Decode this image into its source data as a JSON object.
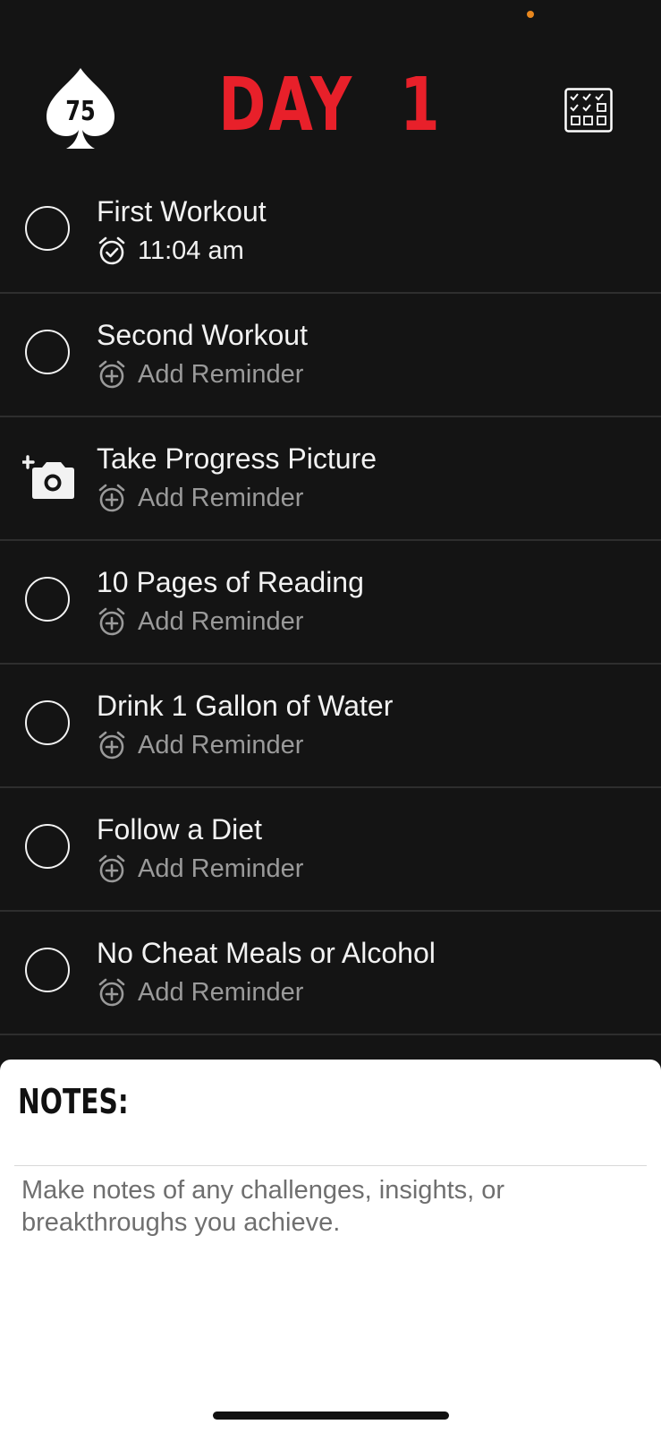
{
  "header": {
    "logo_text": "75",
    "day_title": "DAY  1",
    "calendar_icon": "calendar-checklist-icon"
  },
  "tasks": [
    {
      "title": "First Workout",
      "reminder": "11:04 am",
      "reminder_set": true,
      "control": "checkbox"
    },
    {
      "title": "Second Workout",
      "reminder": "Add Reminder",
      "reminder_set": false,
      "control": "checkbox"
    },
    {
      "title": "Take Progress Picture",
      "reminder": "Add Reminder",
      "reminder_set": false,
      "control": "add-photo"
    },
    {
      "title": "10 Pages of Reading",
      "reminder": "Add Reminder",
      "reminder_set": false,
      "control": "checkbox"
    },
    {
      "title": "Drink 1 Gallon of Water",
      "reminder": "Add Reminder",
      "reminder_set": false,
      "control": "checkbox"
    },
    {
      "title": "Follow a Diet",
      "reminder": "Add Reminder",
      "reminder_set": false,
      "control": "checkbox"
    },
    {
      "title": "No Cheat Meals or Alcohol",
      "reminder": "Add Reminder",
      "reminder_set": false,
      "control": "checkbox"
    }
  ],
  "notes": {
    "title": "NOTES:",
    "placeholder": "Make notes of any challenges, insights, or breakthroughs you achieve.",
    "value": ""
  },
  "colors": {
    "background": "#141414",
    "accent_red": "#e8202a",
    "status_dot": "#e8871e",
    "text_primary": "#f2f2f2",
    "text_muted": "#9a9a9a"
  }
}
